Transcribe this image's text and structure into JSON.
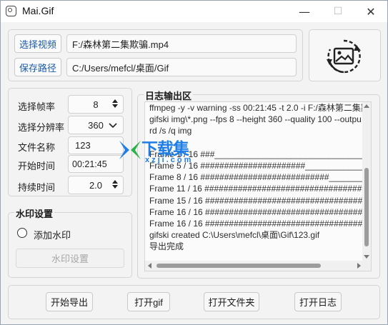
{
  "window": {
    "title": "Mai.Gif",
    "minimize": "—",
    "maximize": "☐",
    "close": "✕"
  },
  "source": {
    "select_video_label": "选择视频",
    "video_path": "F:/森林第二集欺骗.mp4",
    "save_path_label": "保存路径",
    "save_path": "C:/Users/mefcl/桌面/Gif",
    "preview_icon": "image-refresh-icon"
  },
  "settings": {
    "frame_rate_label": "选择帧率",
    "frame_rate_value": "8",
    "resolution_label": "选择分辨率",
    "resolution_value": "360",
    "filename_label": "文件名称",
    "filename_value": "123",
    "start_time_label": "开始时间",
    "start_time_value": "00:21:45",
    "duration_label": "持续时间",
    "duration_value": "2.0"
  },
  "watermark": {
    "group_title": "水印设置",
    "add_label": "添加水印",
    "settings_button": "水印设置"
  },
  "log": {
    "title": "日志输出区",
    "lines": [
      "ffmpeg -y -v warning -ss 00:21:45 -t 2.0 -i F:/森林第二集欺",
      "gifski img\\*.png --fps 8 --height 360 --quality 100 --outpu",
      "rd /s /q img",
      "",
      "Frame 1 / 16 ###_______________________________  5s",
      "Frame 5 / 16 ######################_____________",
      "Frame 8 / 16 ###########################________",
      "Frame 11 / 16 #################################",
      "Frame 15 / 16 #################################",
      "Frame 16 / 16 #################################",
      "Frame 16 / 16 #################################",
      "gifski created C:\\Users\\mefcl\\桌面\\Gif\\123.gif",
      "导出完成"
    ]
  },
  "actions": {
    "start_export": "开始导出",
    "open_gif": "打开gif",
    "open_folder": "打开文件夹",
    "open_log": "打开日志"
  },
  "overlay": {
    "site_name": "下载集",
    "site_domain": "xzji.com"
  }
}
